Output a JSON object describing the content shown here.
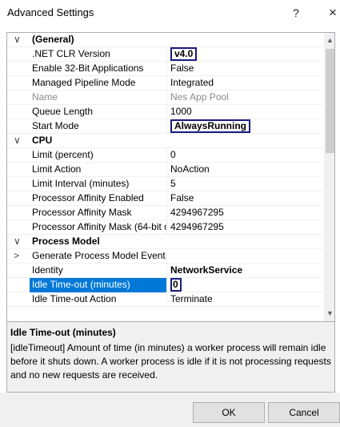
{
  "window": {
    "title": "Advanced Settings",
    "help_glyph": "?",
    "close_glyph": "×"
  },
  "grid": {
    "rows": [
      {
        "type": "category",
        "toggle": "∨",
        "name": "(General)",
        "value": ""
      },
      {
        "type": "prop",
        "name": ".NET CLR Version",
        "value": "v4.0",
        "highlight": true
      },
      {
        "type": "prop",
        "name": "Enable 32-Bit Applications",
        "value": "False"
      },
      {
        "type": "prop",
        "name": "Managed Pipeline Mode",
        "value": "Integrated"
      },
      {
        "type": "prop",
        "name": "Name",
        "value": "Nes App Pool",
        "disabled": true
      },
      {
        "type": "prop",
        "name": "Queue Length",
        "value": "1000"
      },
      {
        "type": "prop",
        "name": "Start Mode",
        "value": "AlwaysRunning",
        "highlight": true
      },
      {
        "type": "category",
        "toggle": "∨",
        "name": "CPU",
        "value": ""
      },
      {
        "type": "prop",
        "name": "Limit (percent)",
        "value": "0"
      },
      {
        "type": "prop",
        "name": "Limit Action",
        "value": "NoAction"
      },
      {
        "type": "prop",
        "name": "Limit Interval (minutes)",
        "value": "5"
      },
      {
        "type": "prop",
        "name": "Processor Affinity Enabled",
        "value": "False"
      },
      {
        "type": "prop",
        "name": "Processor Affinity Mask",
        "value": "4294967295"
      },
      {
        "type": "prop",
        "name": "Processor Affinity Mask (64-bit o",
        "value": "4294967295"
      },
      {
        "type": "category",
        "toggle": "∨",
        "name": "Process Model",
        "value": ""
      },
      {
        "type": "prop",
        "toggle": ">",
        "name": "Generate Process Model Event L",
        "value": ""
      },
      {
        "type": "prop",
        "name": "Identity",
        "value": "NetworkService",
        "bold": true
      },
      {
        "type": "prop",
        "name": "Idle Time-out (minutes)",
        "value": "0",
        "selected": true,
        "highlight": true
      },
      {
        "type": "prop",
        "name": "Idle Time-out Action",
        "value": "Terminate"
      }
    ]
  },
  "scrollbar": {
    "up_glyph": "▲",
    "down_glyph": "▼"
  },
  "description": {
    "title": "Idle Time-out (minutes)",
    "text": "[idleTimeout] Amount of time (in minutes) a worker process will remain idle before it shuts down. A worker process is idle if it is not processing requests and no new requests are received."
  },
  "footer": {
    "ok_label": "OK",
    "cancel_label": "Cancel"
  }
}
